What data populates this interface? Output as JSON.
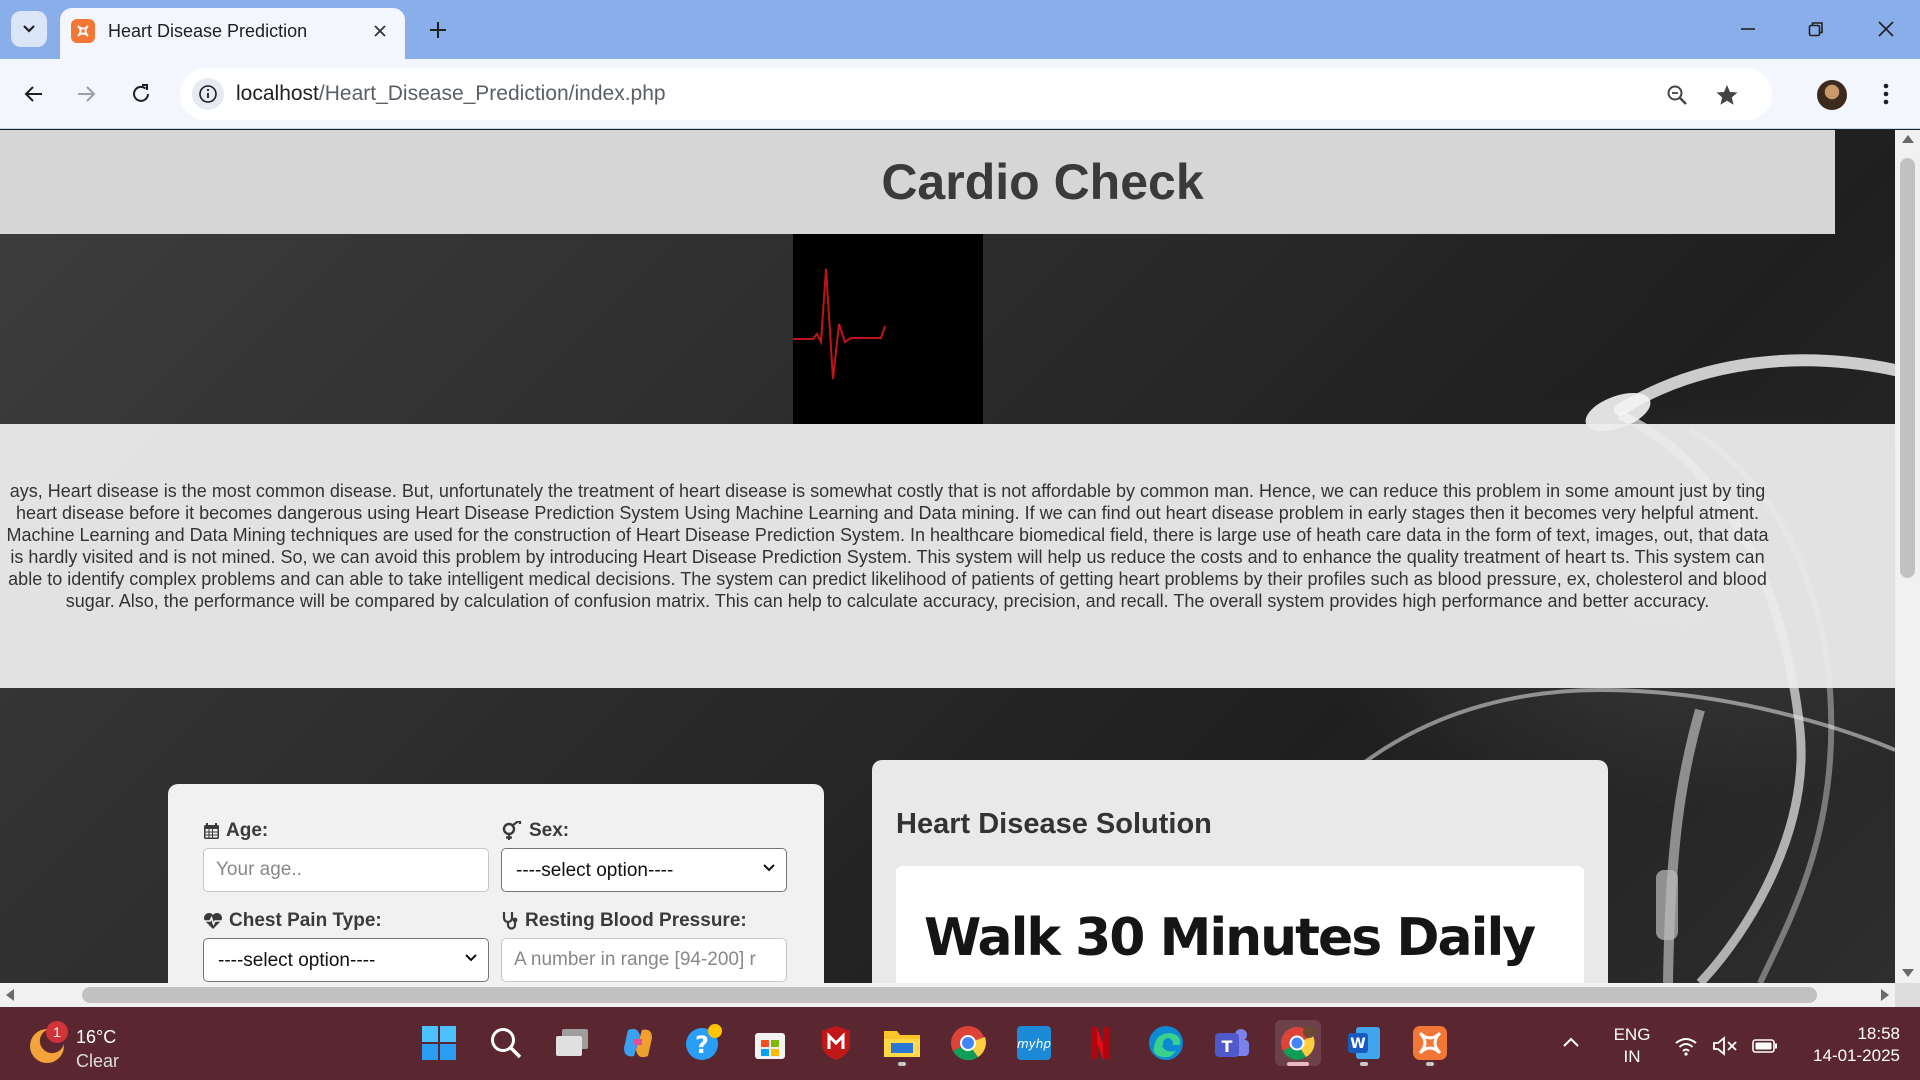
{
  "browser": {
    "tab_title": "Heart Disease Prediction",
    "url_host": "localhost",
    "url_path": "/Heart_Disease_Prediction/index.php"
  },
  "page": {
    "site_title": "Cardio Check",
    "intro_paragraph": "ays, Heart disease is the most common disease. But, unfortunately the treatment of heart disease is somewhat costly that is not affordable by common man. Hence, we can reduce this problem in some amount just by ting heart disease before it becomes dangerous using Heart Disease Prediction System Using Machine Learning and Data mining. If we can find out heart disease problem in early stages then it becomes very helpful atment. Machine Learning and Data Mining techniques are used for the construction of Heart Disease Prediction System. In healthcare biomedical field, there is large use of heath care data in the form of text, images, out, that data is hardly visited and is not mined. So, we can avoid this problem by introducing Heart Disease Prediction System. This system will help us reduce the costs and to enhance the quality treatment of heart ts. This system can able to identify complex problems and can able to take intelligent medical decisions. The system can predict likelihood of patients of getting heart problems by their profiles such as blood pressure, ex, cholesterol and blood sugar. Also, the performance will be compared by calculation of confusion matrix. This can help to calculate accuracy, precision, and recall. The overall system provides high performance and better accuracy.",
    "form": {
      "age_label": "Age:",
      "age_placeholder": "Your age..",
      "sex_label": "Sex:",
      "sex_value": "----select option----",
      "chest_pain_label": "Chest Pain Type:",
      "chest_pain_value": "----select option----",
      "bp_label": "Resting Blood Pressure:",
      "bp_placeholder": "A number in range [94-200] r"
    },
    "solution": {
      "title": "Heart Disease Solution",
      "headline": "Walk 30 Minutes Daily"
    }
  },
  "taskbar": {
    "weather_temp": "16°C",
    "weather_cond": "Clear",
    "weather_badge": "1",
    "lang_line1": "ENG",
    "lang_line2": "IN",
    "time": "18:58",
    "date": "14-01-2025"
  },
  "colors": {
    "tabstrip": "#8aaee9",
    "taskbar": "#5a2730",
    "header_band": "#d6d6d6",
    "ecg_line": "#c0141a"
  }
}
